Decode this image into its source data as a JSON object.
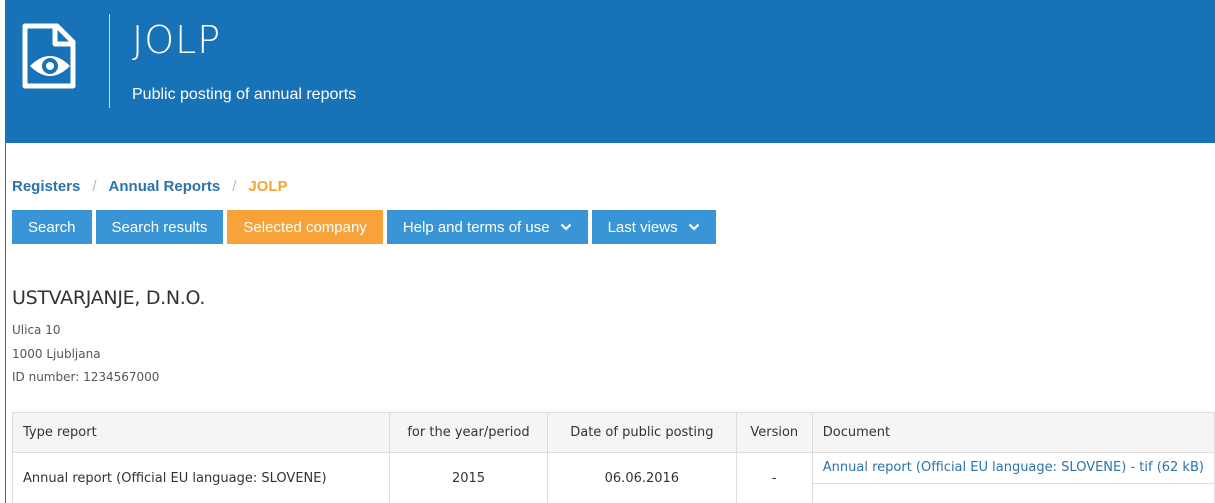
{
  "header": {
    "app_title": "JOLP",
    "app_subtitle": "Public posting of annual reports",
    "logo_icon": "document-eye-icon",
    "background_color": "#1872b8"
  },
  "breadcrumb": {
    "items": [
      "Registers",
      "Annual Reports"
    ],
    "current": "JOLP",
    "link_color": "#2a74ad",
    "current_color": "#f4a431"
  },
  "nav": {
    "items": [
      "Search",
      "Search results",
      "Selected company",
      "Help and terms of use",
      "Last views"
    ],
    "active_index": 2,
    "button_color": "#3a95d6",
    "active_color": "#f8a33a"
  },
  "company": {
    "name": "USTVARJANJE, D.N.O.",
    "street": "Ulica 10",
    "city": "1000 Ljubljana",
    "id_number": "ID number: 1234567000"
  },
  "table": {
    "headers": [
      "Type report",
      "for the year/period",
      "Date of public posting",
      "Version",
      "Document"
    ],
    "rows": [
      {
        "type": "Annual report (Official EU language: SLOVENE)",
        "year": "2015",
        "date": "06.06.2016",
        "version": "-",
        "document": "Annual report (Official EU language: SLOVENE) - tif (62 kB)"
      }
    ]
  }
}
